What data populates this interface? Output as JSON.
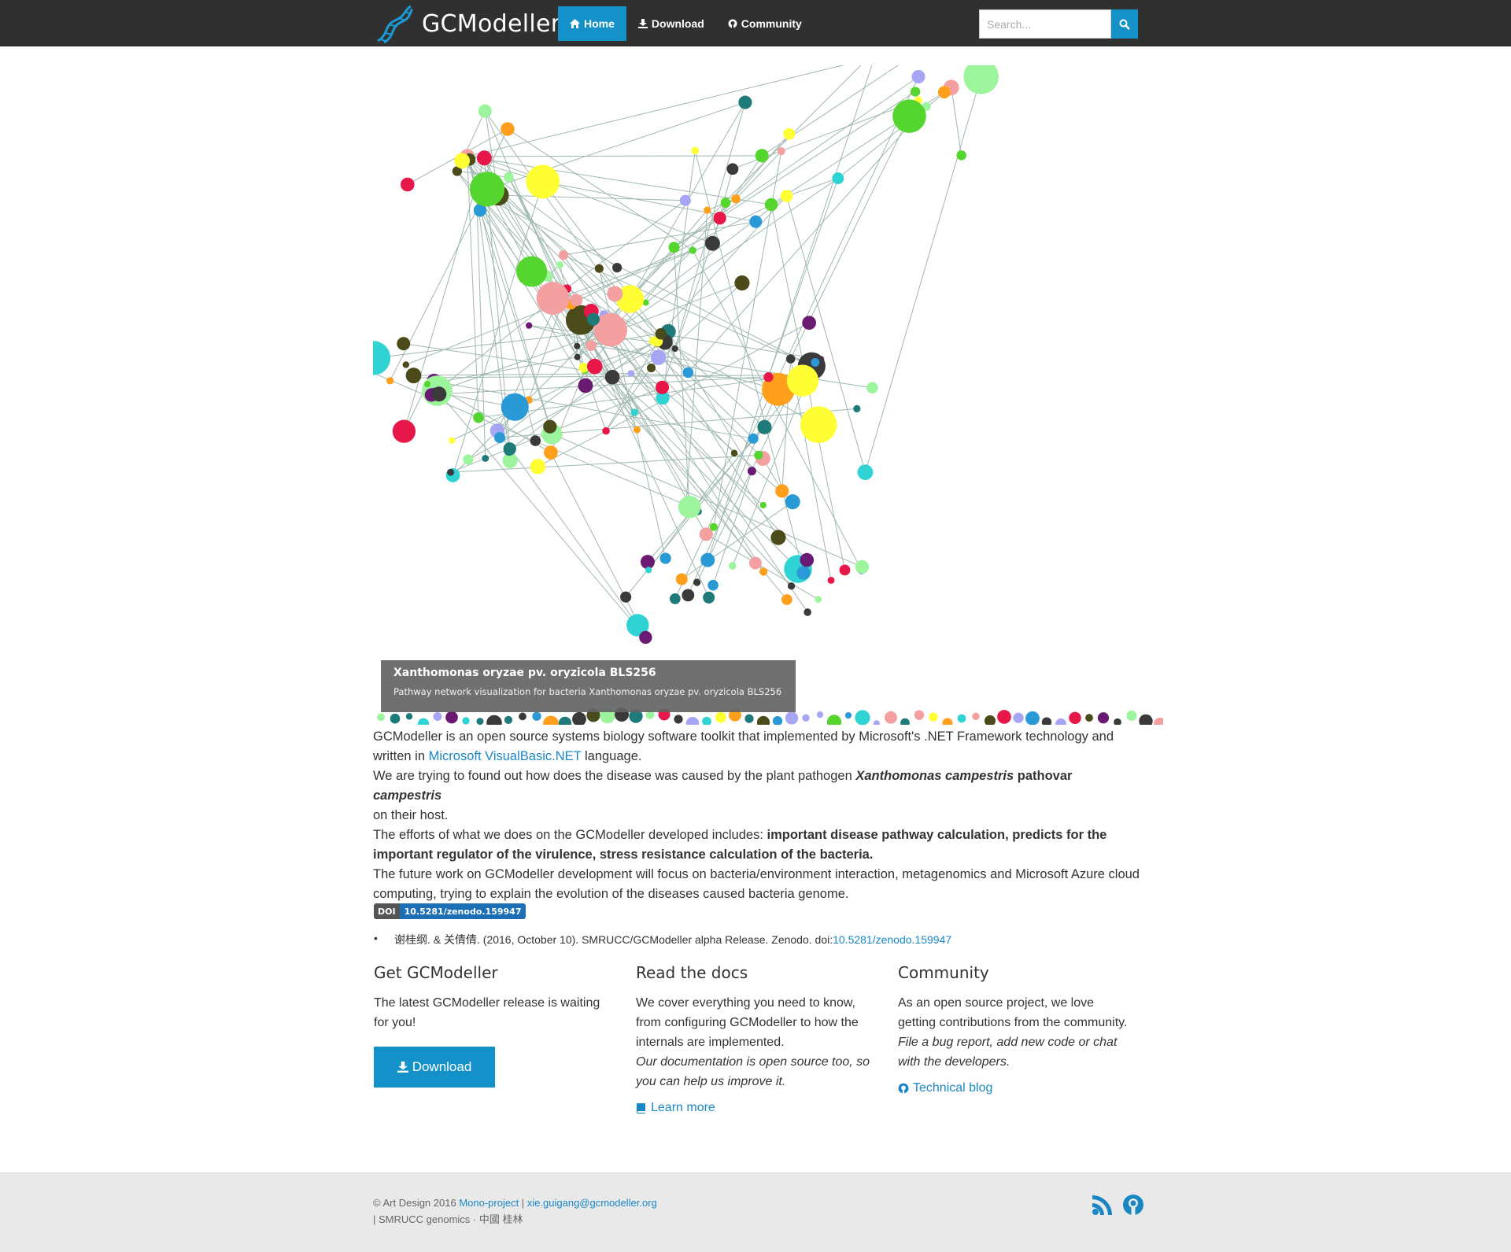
{
  "navbar": {
    "brand": "GCModeller",
    "items": [
      {
        "label": "Home",
        "icon": "home-icon",
        "active": true
      },
      {
        "label": "Download",
        "icon": "download-icon",
        "active": false
      },
      {
        "label": "Community",
        "icon": "github-icon",
        "active": false
      }
    ],
    "search_placeholder": "Search...",
    "accent": "#1491c9",
    "background": "#303030"
  },
  "hero": {
    "caption_title": "Xanthomonas oryzae pv. oryzicola BLS256",
    "caption_subtitle": "Pathway network visualization for bacteria Xanthomonas oryzae pv. oryzicola BLS256"
  },
  "intro": {
    "p1_before": "GCModeller is an open source systems biology software toolkit that implemented by Microsoft's .NET Framework technology and written in ",
    "p1_link": "Microsoft VisualBasic.NET",
    "p1_after": " language.",
    "p2_before": "We are trying to found out how does the disease was caused by the plant pathogen ",
    "p2_species": "Xanthomonas campestris",
    "p2_pathovar": " pathovar ",
    "p2_pathovar_name": "campestris",
    "p2_after": " on their host.",
    "p3_before": "The efforts of what we does on the GCModeller developed includes: ",
    "p3_bold": "important disease pathway calculation, predicts for the important regulator of the virulence, stress resistance calculation of the bacteria.",
    "p4": "The future work on GCModeller development will focus on bacteria/environment interaction, metagenomics and Microsoft Azure cloud computing, trying to explain the evolution of the diseases caused bacteria genome."
  },
  "doi_badge": {
    "left": "DOI",
    "right": "10.5281/zenodo.159947"
  },
  "citation": {
    "bullet": "•",
    "text": "谢桂纲. & 关倩倩. (2016, October 10). SMRUCC/GCModeller alpha Release. Zenodo. doi:",
    "link": "10.5281/zenodo.159947"
  },
  "columns": {
    "get": {
      "title": "Get GCModeller",
      "text": "The latest GCModeller release is waiting for you!",
      "button": "Download"
    },
    "docs": {
      "title": "Read the docs",
      "text": "We cover everything you need to know, from configuring GCModeller to how the internals are implemented.",
      "em": "Our documentation is open source too, so you can help us improve it.",
      "link": "Learn more"
    },
    "community": {
      "title": "Community",
      "text": "As an open source project, we love getting contributions from the community.",
      "em": "File a bug report, add new code or chat with the developers.",
      "link": "Technical blog"
    }
  },
  "footer": {
    "copyright": "© Art Design 2016 ",
    "link1": "Mono-project",
    "sep": " | ",
    "link2": "xie.guigang@gcmodeller.org",
    "line2": "| SMRUCC genomics · 中國 桂林",
    "icons": [
      "rss-icon",
      "github-icon"
    ]
  }
}
